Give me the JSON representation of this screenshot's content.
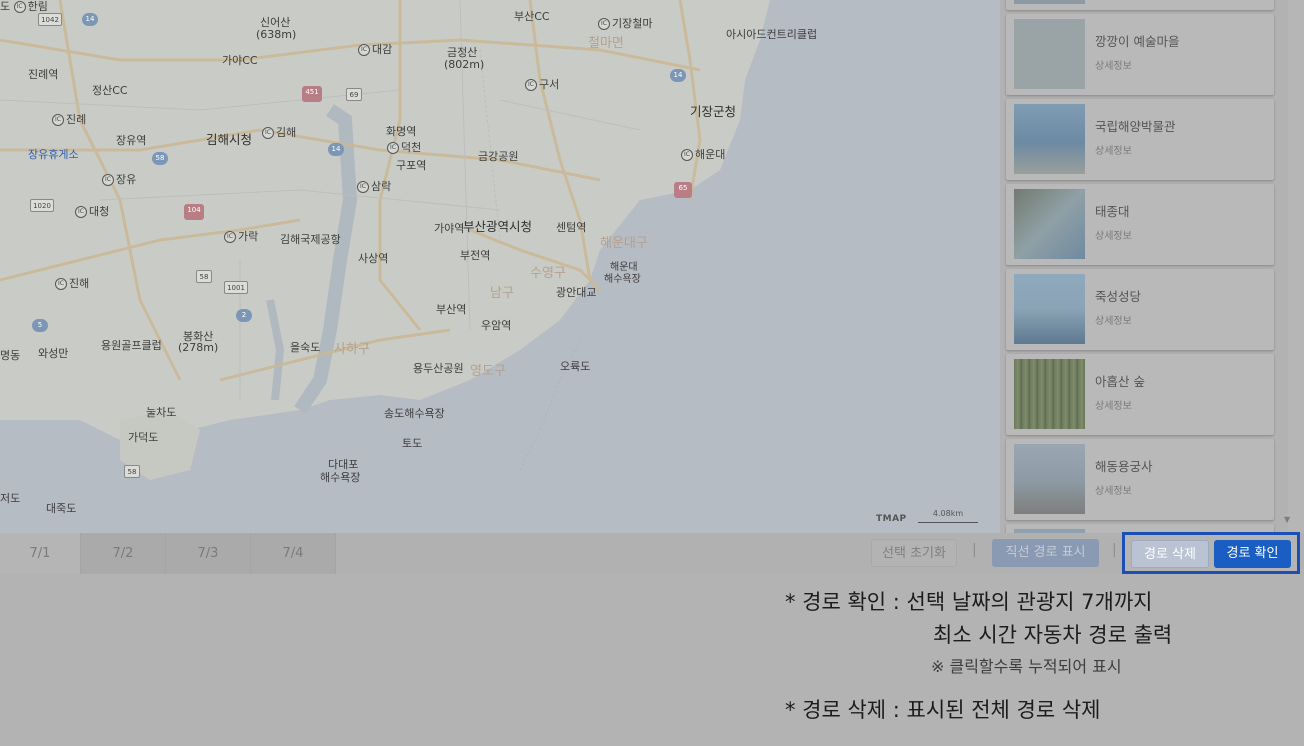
{
  "map": {
    "labels": {
      "hanrim": "한림",
      "busancc": "부산CC",
      "gijang_cheolma": "기장철마",
      "asiad_cc": "아시아드컨트리클럽",
      "sineosan": "신어산",
      "sineosan_h": "(638m)",
      "daegam": "대감",
      "geumjeongsan": "금정산",
      "geumjeongsan_h": "(802m)",
      "cheolma": "철마면",
      "jinrye": "진례역",
      "gayacc": "가야CC",
      "jeongsancc": "정산CC",
      "guseo": "구서",
      "gijang_office": "기장군청",
      "jinrye_ic": "진례",
      "hwamyeong": "화명역",
      "jangyu_st": "장유역",
      "gimhae_city": "김해시청",
      "gimhae_ic": "김해",
      "deokcheon": "덕천",
      "gupo": "구포역",
      "geumgang_park": "금강공원",
      "haeundae_ic": "해운대",
      "jangyu_rest": "장유휴게소",
      "jangyu_ic": "장유",
      "samrak": "삼락",
      "daecheong": "대청",
      "gaya_st": "가야역",
      "busan_city_hall": "부산광역시청",
      "centum": "센텀역",
      "garak": "가락",
      "gimhae_airport": "김해국제공항",
      "sasang": "사상역",
      "bujeon": "부전역",
      "haeundae_area": "해운대구",
      "haeundae_beach": "해운대",
      "haeundae_beach2": "해수욕장",
      "jinhae": "진해",
      "suyeong": "수영구",
      "namgu": "남구",
      "gwangan": "광안대교",
      "busan_st": "부산역",
      "uam": "우암역",
      "yongwon": "용원골프클럽",
      "bonghwasan": "봉화산",
      "bonghwasan_h": "(278m)",
      "eulsukdo": "을숙도",
      "saha": "사하구",
      "yongdusan": "용두산공원",
      "yeongdo": "영도구",
      "oryukdo": "오륙도",
      "nulchado": "눌차도",
      "songdo": "송도해수욕장",
      "gadeokdo": "가덕도",
      "dadaepo": "다대포",
      "dadaepo2": "해수욕장",
      "todo": "토도",
      "jeodo": "저도",
      "daejukdo": "대죽도",
      "wasangsan": "와성만",
      "nameum_ic": "명동"
    },
    "badges": {
      "b1042": "1042",
      "b14a": "14",
      "b14b": "14",
      "b451": "451",
      "b69": "69",
      "b14c": "14",
      "b58a": "58",
      "b14d": "14",
      "b65": "65",
      "b1020": "1020",
      "b104": "104",
      "b58b": "58",
      "b1001": "1001",
      "b2": "2",
      "b58c": "58",
      "b5": "5"
    },
    "tmap": "TMAP",
    "scale": "4.08km"
  },
  "list": {
    "items": [
      {
        "name": "깡깡이 예술마을",
        "detail": "상세정보"
      },
      {
        "name": "국립해양박물관",
        "detail": "상세정보"
      },
      {
        "name": "태종대",
        "detail": "상세정보"
      },
      {
        "name": "죽성성당",
        "detail": "상세정보"
      },
      {
        "name": "아홉산 숲",
        "detail": "상세정보"
      },
      {
        "name": "해동용궁사",
        "detail": "상세정보"
      }
    ]
  },
  "tabs": [
    "7/1",
    "7/2",
    "7/3",
    "7/4"
  ],
  "buttons": {
    "reset": "선택 초기화",
    "line_route": "직선 경로 표시",
    "delete_route": "경로 삭제",
    "confirm_route": "경로 확인"
  },
  "notes": {
    "confirm_line1": "* 경로 확인 : 선택 날짜의 관광지 7개까지",
    "confirm_line2": "최소 시간 자동차 경로 출력",
    "confirm_line3": "※ 클릭할수록 누적되어 표시",
    "delete_line": "* 경로 삭제 : 표시된 전체 경로 삭제"
  },
  "colors": {
    "highlight_border": "#1b4fb5",
    "confirm_button": "#1a5ec4"
  }
}
